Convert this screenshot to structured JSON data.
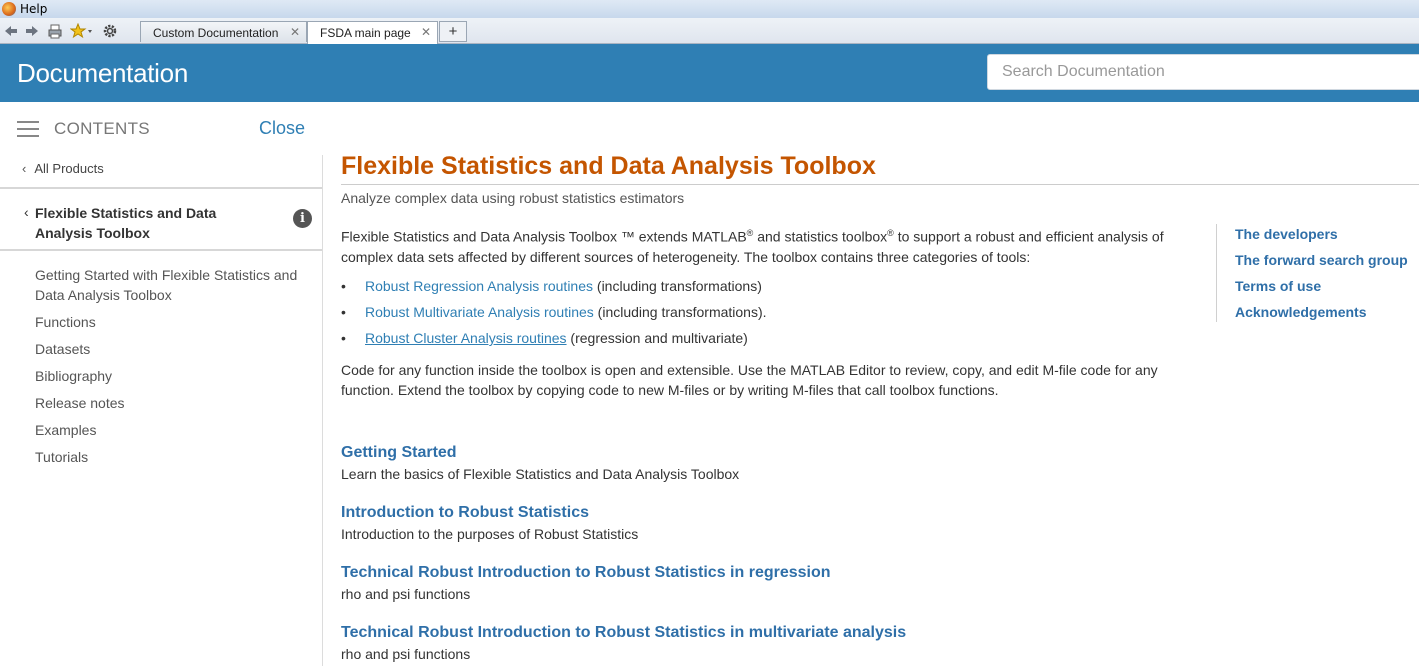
{
  "window": {
    "title": "Help"
  },
  "tabs": [
    {
      "label": "Custom Documentation",
      "close": "✕"
    },
    {
      "label": "FSDA main page",
      "close": "✕"
    }
  ],
  "tab_add_label": "+",
  "header": {
    "title": "Documentation",
    "search_placeholder": "Search Documentation"
  },
  "sidebar": {
    "contents_label": "CONTENTS",
    "close_label": "Close",
    "all_products": "All Products",
    "section_title": "Flexible Statistics and Data Analysis Toolbox",
    "info_glyph": "i",
    "items": [
      "Getting Started with Flexible Statistics and Data Analysis Toolbox",
      "Functions",
      "Datasets",
      "Bibliography",
      "Release notes",
      "Examples",
      "Tutorials"
    ]
  },
  "main": {
    "title": "Flexible Statistics and Data Analysis Toolbox",
    "subtitle": "Analyze complex data using robust statistics estimators",
    "intro_part1": "Flexible Statistics and Data Analysis Toolbox ™ extends MATLAB",
    "intro_reg": "®",
    "intro_part2": " and statistics toolbox",
    "intro_part3": " to support a robust and efficient analysis of complex data sets affected by different sources of heterogeneity. The toolbox contains three categories of tools:",
    "bullet_glyph": "•",
    "bullets": [
      {
        "link": "Robust Regression Analysis routines",
        "rest": " (including transformations)"
      },
      {
        "link": "Robust Multivariate Analysis routines",
        "rest": " (including transformations)."
      },
      {
        "link": "Robust Cluster Analysis routines",
        "rest": " (regression and multivariate)"
      }
    ],
    "code_para": "Code for any function inside the toolbox is open and extensible. Use the MATLAB Editor to review, copy, and edit M-file code for any function. Extend the toolbox by copying code to new M-files or by writing M-files that call toolbox functions.",
    "sections": [
      {
        "heading": "Getting Started",
        "desc": "Learn the basics of Flexible Statistics and Data Analysis Toolbox"
      },
      {
        "heading": "Introduction to Robust Statistics",
        "desc": "Introduction to the purposes of Robust Statistics"
      },
      {
        "heading": "Technical Robust Introduction to Robust Statistics in regression",
        "desc": "rho and psi functions"
      },
      {
        "heading": "Technical Robust Introduction to Robust Statistics in multivariate analysis",
        "desc": "rho and psi functions"
      }
    ]
  },
  "right_rail": {
    "links": [
      "The developers",
      "The forward search group",
      "Terms of use",
      "Acknowledgements"
    ]
  },
  "colors": {
    "header_blue": "#2f7fb4",
    "title_orange": "#c45500",
    "link_blue": "#2f6fa8"
  },
  "icons": {
    "back": "back-arrow-icon",
    "forward": "forward-arrow-icon",
    "print": "print-icon",
    "favorites": "star-icon",
    "settings": "gear-icon",
    "menu": "hamburger-icon",
    "info": "info-icon"
  }
}
